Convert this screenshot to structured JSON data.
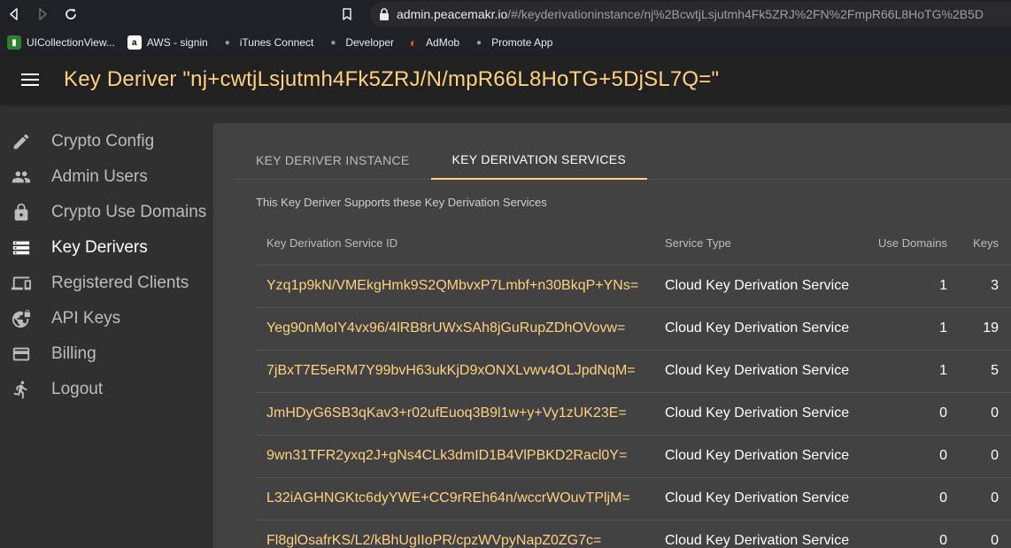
{
  "browser": {
    "url_host": "admin.peacemakr.io",
    "url_rest": "/#/keyderivationinstance/nj%2BcwtjLsjutmh4Fk5ZRJ%2FN%2FmpR66L8HoTG%2B5D",
    "bookmarks": [
      {
        "label": "UICollectionView...",
        "icon": "folder-icon",
        "color": "#2e7d32"
      },
      {
        "label": "AWS - signin",
        "icon": "aws-icon",
        "color": "#ffffff"
      },
      {
        "label": "iTunes Connect",
        "icon": "apple-icon",
        "color": "#9e9e9e"
      },
      {
        "label": "Developer",
        "icon": "apple-icon",
        "color": "#9e9e9e"
      },
      {
        "label": "AdMob",
        "icon": "admob-icon",
        "color": "#f4511e"
      },
      {
        "label": "Promote App",
        "icon": "apple-icon",
        "color": "#9e9e9e"
      }
    ]
  },
  "header": {
    "title": "Key Deriver \"nj+cwtjLsjutmh4Fk5ZRJ/N/mpR66L8HoTG+5DjSL7Q=\""
  },
  "sidebar": {
    "items": [
      {
        "label": "Crypto Config",
        "icon": "pencil-icon"
      },
      {
        "label": "Admin Users",
        "icon": "people-icon"
      },
      {
        "label": "Crypto Use Domains",
        "icon": "lock-icon"
      },
      {
        "label": "Key Derivers",
        "icon": "storage-icon",
        "active": true
      },
      {
        "label": "Registered Clients",
        "icon": "devices-icon"
      },
      {
        "label": "API Keys",
        "icon": "vpn-lock-icon"
      },
      {
        "label": "Billing",
        "icon": "credit-card-icon"
      },
      {
        "label": "Logout",
        "icon": "directions-run-icon"
      }
    ]
  },
  "tabs": {
    "instance": "KEY DERIVER INSTANCE",
    "services": "KEY DERIVATION SERVICES"
  },
  "content": {
    "subtitle": "This Key Deriver Supports these Key Derivation Services"
  },
  "table": {
    "headers": {
      "id": "Key Derivation Service ID",
      "type": "Service Type",
      "domains": "Use Domains",
      "keys": "Keys"
    },
    "rows": [
      {
        "id": "Yzq1p9kN/VMEkgHmk9S2QMbvxP7Lmbf+n30BkqP+YNs=",
        "type": "Cloud Key Derivation Service",
        "domains": "1",
        "keys": "3"
      },
      {
        "id": "Yeg90nMoIY4vx96/4lRB8rUWxSAh8jGuRupZDhOVovw=",
        "type": "Cloud Key Derivation Service",
        "domains": "1",
        "keys": "19"
      },
      {
        "id": "7jBxT7E5eRM7Y99bvH63ukKjD9xONXLvwv4OLJpdNqM=",
        "type": "Cloud Key Derivation Service",
        "domains": "1",
        "keys": "5"
      },
      {
        "id": "JmHDyG6SB3qKav3+r02ufEuoq3B9l1w+y+Vy1zUK23E=",
        "type": "Cloud Key Derivation Service",
        "domains": "0",
        "keys": "0"
      },
      {
        "id": "9wn31TFR2yxq2J+gNs4CLk3dmID1B4VlPBKD2Racl0Y=",
        "type": "Cloud Key Derivation Service",
        "domains": "0",
        "keys": "0"
      },
      {
        "id": "L32iAGHNGKtc6dyYWE+CC9rREh64n/wccrWOuvTPljM=",
        "type": "Cloud Key Derivation Service",
        "domains": "0",
        "keys": "0"
      },
      {
        "id": "Fl8glOsafrKS/L2/kBhUgIIoPR/cpzWVpyNapZ0ZG7c=",
        "type": "Cloud Key Derivation Service",
        "domains": "0",
        "keys": "0"
      }
    ]
  },
  "colors": {
    "accent": "#ffd180",
    "card": "#424242",
    "background": "#303030"
  }
}
